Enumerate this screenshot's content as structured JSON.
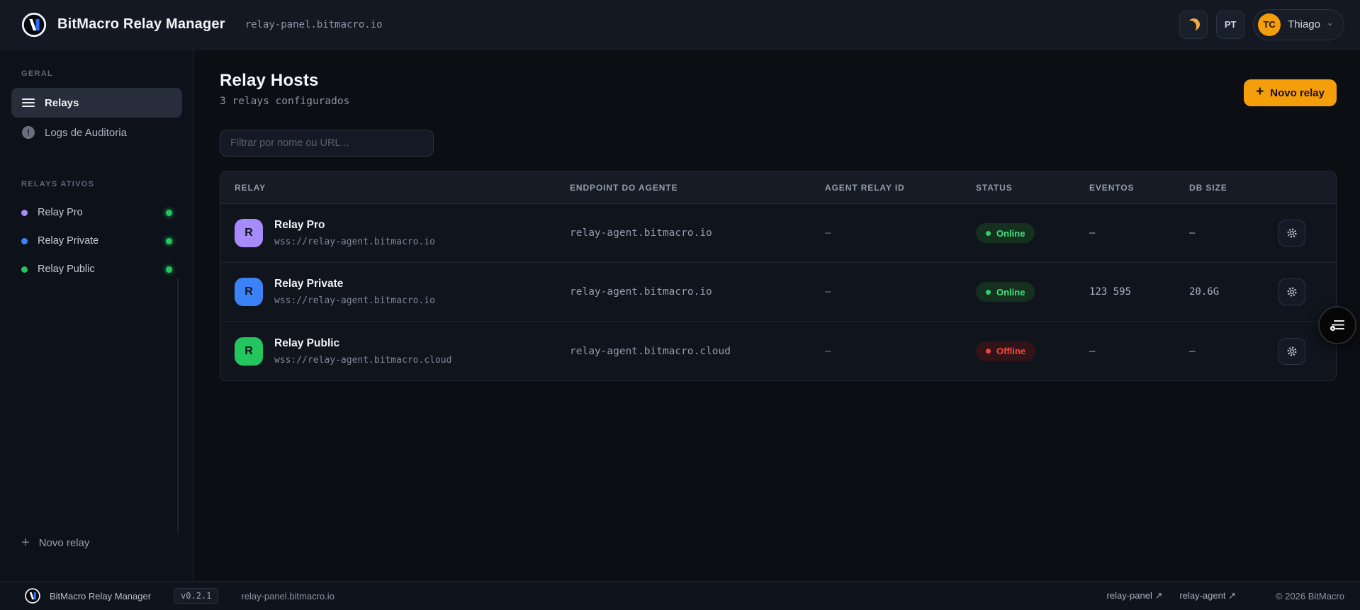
{
  "header": {
    "brand": "BitMacro Relay Manager",
    "host": "relay-panel.bitmacro.io",
    "language": "PT",
    "user": {
      "initials": "TC",
      "name": "Thiago"
    }
  },
  "sidebar": {
    "general_label": "GERAL",
    "active_relays_label": "RELAYS ATIVOS",
    "nav": [
      {
        "label": "Relays",
        "icon": "menu-icon",
        "active": true
      },
      {
        "label": "Logs de Auditoria",
        "icon": "alert-icon",
        "active": false
      }
    ],
    "alert_glyph": "!",
    "relays": [
      {
        "label": "Relay Pro",
        "dot_color": "#a78bfa",
        "status_color": "#22c55e"
      },
      {
        "label": "Relay Private",
        "dot_color": "#3b82f6",
        "status_color": "#22c55e"
      },
      {
        "label": "Relay Public",
        "dot_color": "#22c55e",
        "status_color": "#22c55e"
      }
    ],
    "new_relay_label": "Novo relay",
    "plus_glyph": "+"
  },
  "main": {
    "title": "Relay Hosts",
    "subtitle": "3 relays configurados",
    "new_relay_button": "Novo relay",
    "plus_glyph": "+",
    "filter_placeholder": "Filtrar por nome ou URL...",
    "table": {
      "columns": [
        "RELAY",
        "ENDPOINT DO AGENTE",
        "AGENT RELAY ID",
        "STATUS",
        "EVENTOS",
        "DB SIZE"
      ],
      "rows": [
        {
          "name": "Relay Pro",
          "url": "wss://relay-agent.bitmacro.io",
          "avatar_letter": "R",
          "avatar_color": "#a78bfa",
          "endpoint": "relay-agent.bitmacro.io",
          "agent_relay_id": "–",
          "status": "Online",
          "status_type": "online",
          "eventos": "–",
          "db_size": "–"
        },
        {
          "name": "Relay Private",
          "url": "wss://relay-agent.bitmacro.io",
          "avatar_letter": "R",
          "avatar_color": "#3b82f6",
          "endpoint": "relay-agent.bitmacro.io",
          "agent_relay_id": "–",
          "status": "Online",
          "status_type": "online",
          "eventos": "123 595",
          "db_size": "20.6G"
        },
        {
          "name": "Relay Public",
          "url": "wss://relay-agent.bitmacro.cloud",
          "avatar_letter": "R",
          "avatar_color": "#22c55e",
          "endpoint": "relay-agent.bitmacro.cloud",
          "agent_relay_id": "–",
          "status": "Offline",
          "status_type": "offline",
          "eventos": "–",
          "db_size": "–"
        }
      ]
    }
  },
  "footer": {
    "brand": "BitMacro Relay Manager",
    "version": "v0.2.1",
    "host": "relay-panel.bitmacro.io",
    "separator": "·",
    "links": [
      {
        "label": "relay-panel",
        "arrow": "↗"
      },
      {
        "label": "relay-agent",
        "arrow": "↗"
      }
    ],
    "copyright": "© 2026 BitMacro"
  },
  "colors": {
    "accent_orange": "#f59e0b",
    "online_green": "#22c55e",
    "offline_red": "#ef4444",
    "relay_pro_purple": "#a78bfa",
    "relay_private_blue": "#3b82f6",
    "relay_public_green": "#22c55e"
  }
}
